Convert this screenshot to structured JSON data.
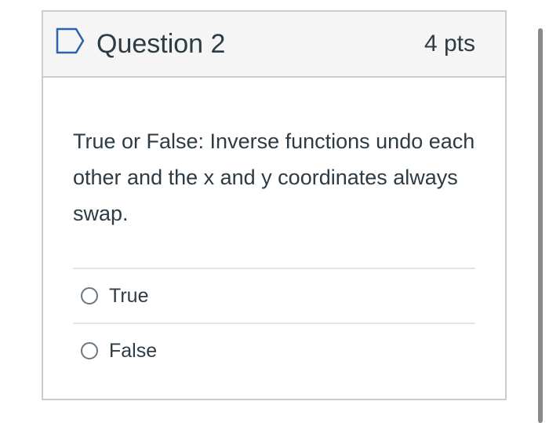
{
  "question": {
    "flag_icon": "bookmark-flag-icon",
    "title": "Question 2",
    "points": "4 pts",
    "text": "True or False: Inverse functions undo each other and the x and y coordinates always swap."
  },
  "answers": [
    {
      "label": "True",
      "selected": false
    },
    {
      "label": "False",
      "selected": false
    }
  ],
  "colors": {
    "text": "#2d3b45",
    "header_bg": "#f5f5f5",
    "border": "#c7cdd1",
    "flag": "#2b63a8"
  }
}
